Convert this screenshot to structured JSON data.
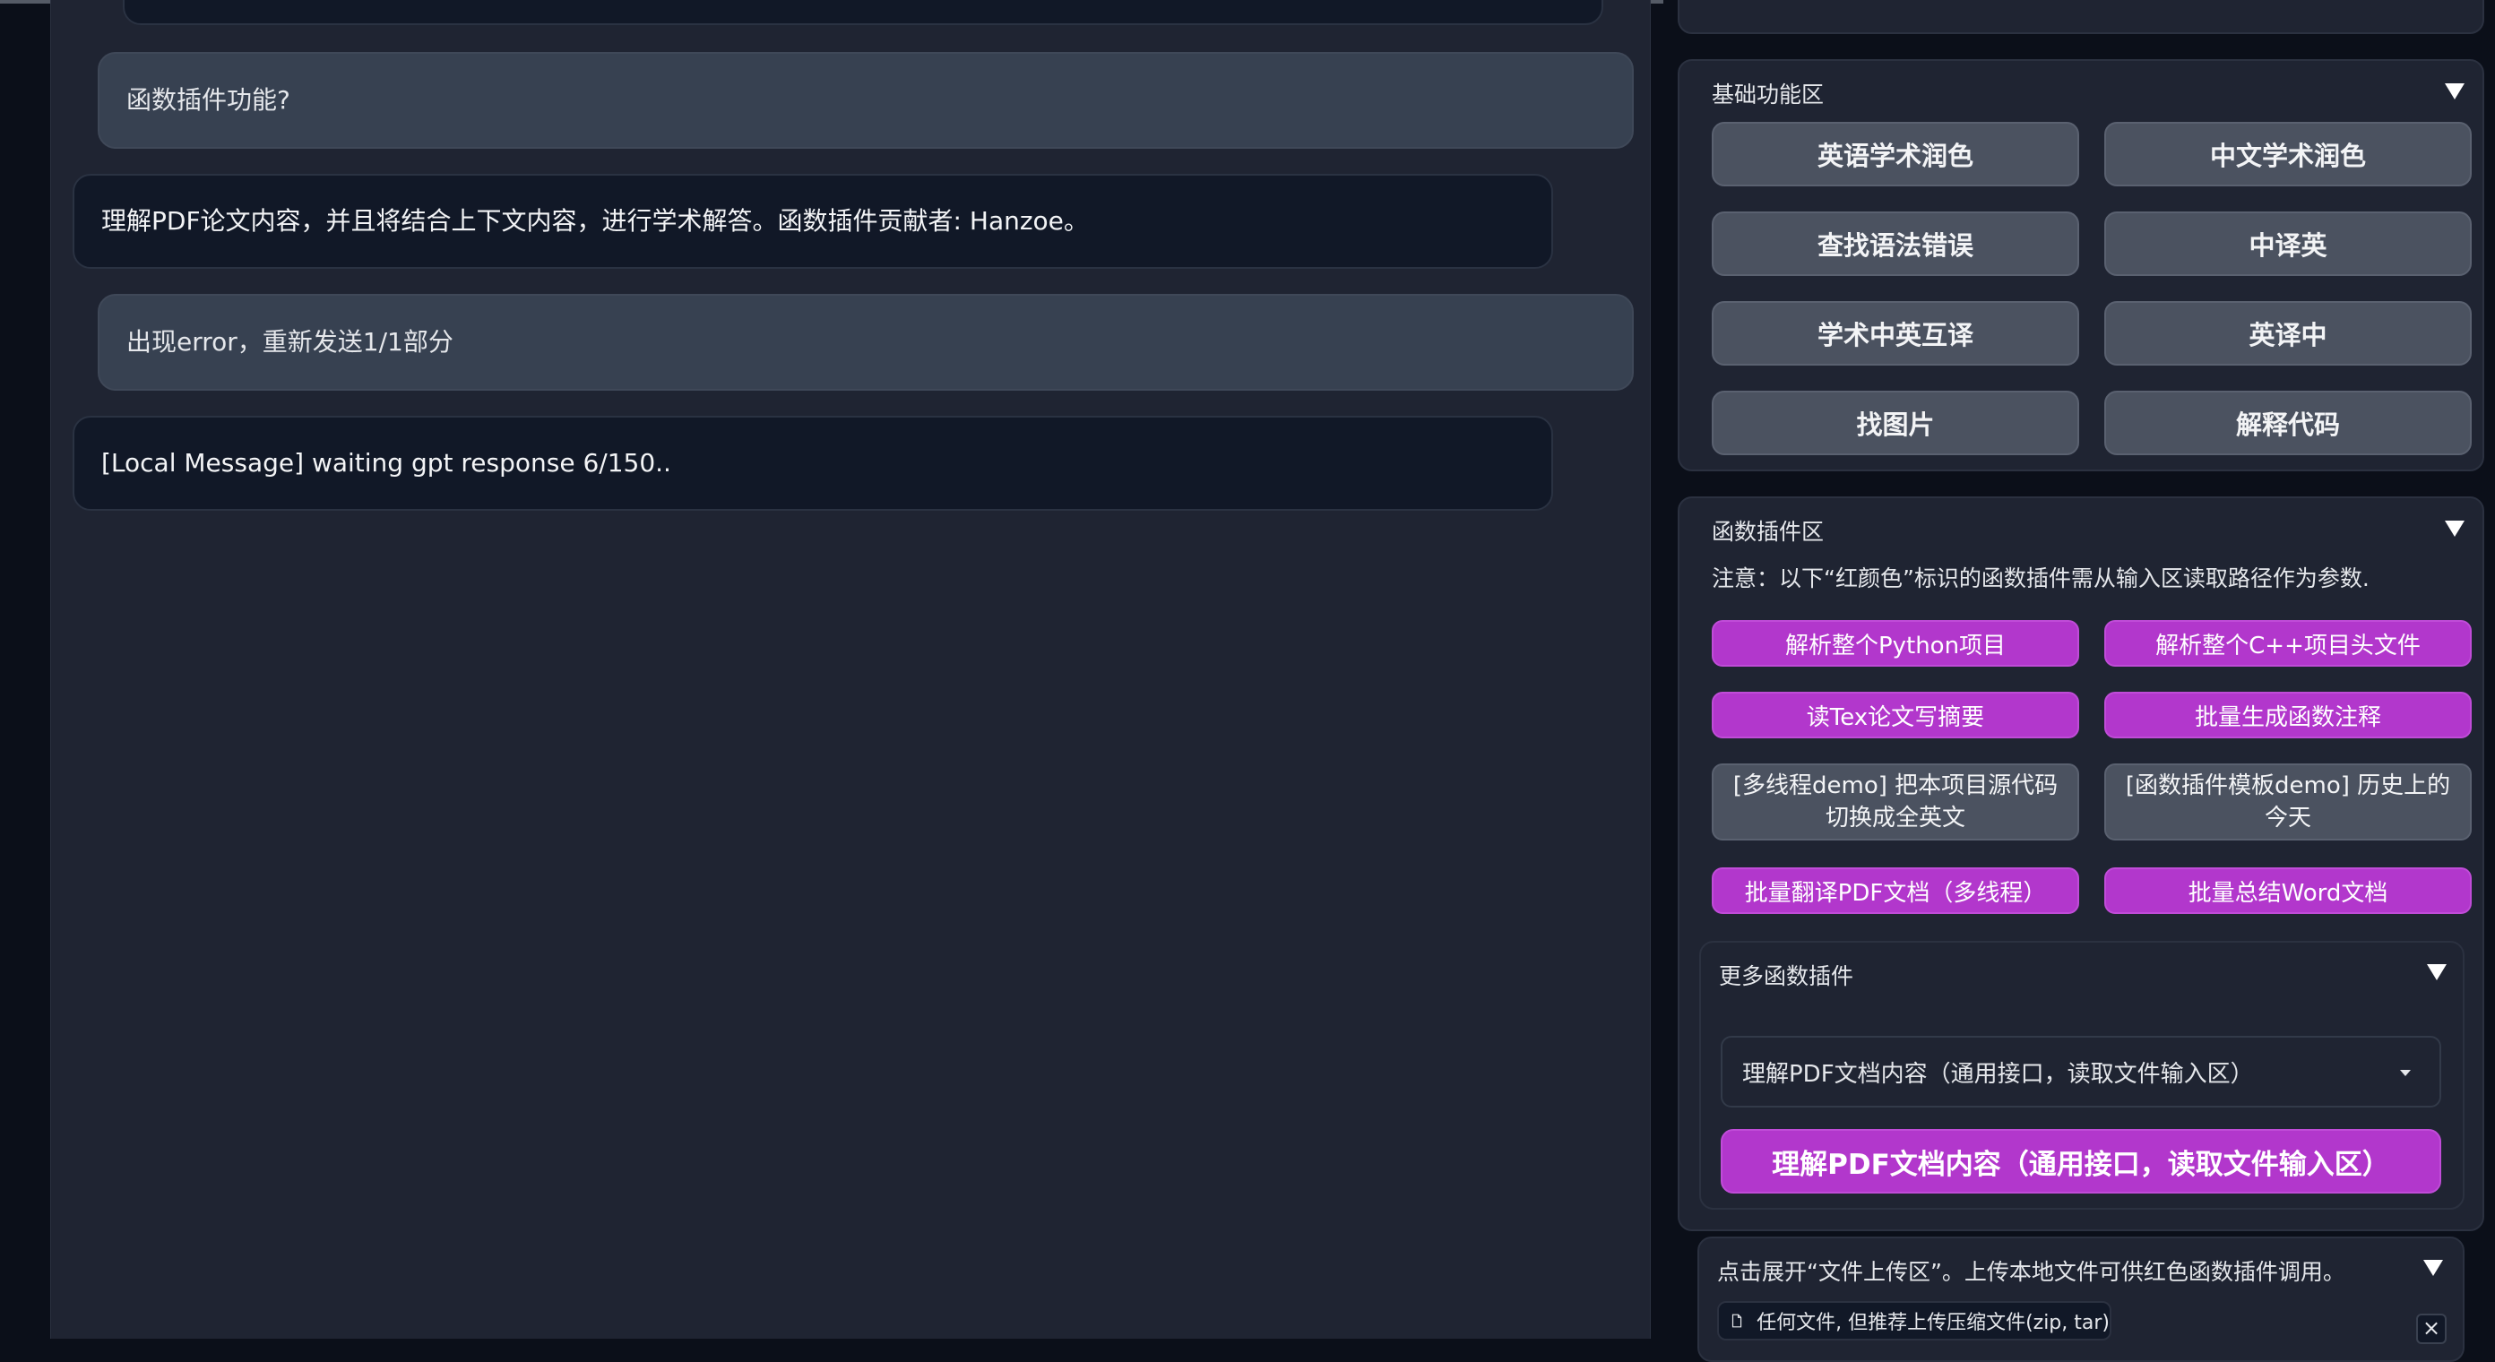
{
  "chat": {
    "messages": [
      {
        "role": "user",
        "text": "函数插件功能?"
      },
      {
        "role": "assistant",
        "text": "理解PDF论文内容，并且将结合上下文内容，进行学术解答。函数插件贡献者: Hanzoe。"
      },
      {
        "role": "user",
        "text": "出现error，重新发送1/1部分"
      },
      {
        "role": "assistant",
        "text": "[Local Message] waiting gpt response 6/150.."
      }
    ]
  },
  "basic_panel": {
    "title": "基础功能区",
    "buttons": [
      "英语学术润色",
      "中文学术润色",
      "查找语法错误",
      "中译英",
      "学术中英互译",
      "英译中",
      "找图片",
      "解释代码"
    ]
  },
  "plugin_panel": {
    "title": "函数插件区",
    "note": "注意：以下“红颜色”标识的函数插件需从输入区读取路径作为参数.",
    "buttons": [
      {
        "label": "解析整个Python项目",
        "style": "purple"
      },
      {
        "label": "解析整个C++项目头文件",
        "style": "purple"
      },
      {
        "label": "读Tex论文写摘要",
        "style": "purple"
      },
      {
        "label": "批量生成函数注释",
        "style": "purple"
      },
      {
        "label": "[多线程demo] 把本项目源代码切换成全英文",
        "style": "gray"
      },
      {
        "label": "[函数插件模板demo] 历史上的今天",
        "style": "gray"
      },
      {
        "label": "批量翻译PDF文档（多线程）",
        "style": "purple"
      },
      {
        "label": "批量总结Word文档",
        "style": "purple"
      }
    ],
    "more": {
      "title": "更多函数插件",
      "selected": "理解PDF文档内容（通用接口，读取文件输入区）",
      "run_button": "理解PDF文档内容（通用接口，读取文件输入区）"
    }
  },
  "upload_panel": {
    "title": "点击展开“文件上传区”。上传本地文件可供红色函数插件调用。",
    "file_hint": "任何文件, 但推荐上传压缩文件(zip, tar)",
    "close_label": "×"
  },
  "icons": {
    "collapse": "triangle-down-icon",
    "dropdown": "caret-down-icon",
    "file": "file-icon",
    "close": "close-icon"
  },
  "colors": {
    "background": "#0b0f19",
    "panel": "#1f2432",
    "user_bubble": "#374151",
    "bot_bubble": "#111827",
    "gray_button": "#4b5260",
    "accent_purple": "#b237cc"
  }
}
